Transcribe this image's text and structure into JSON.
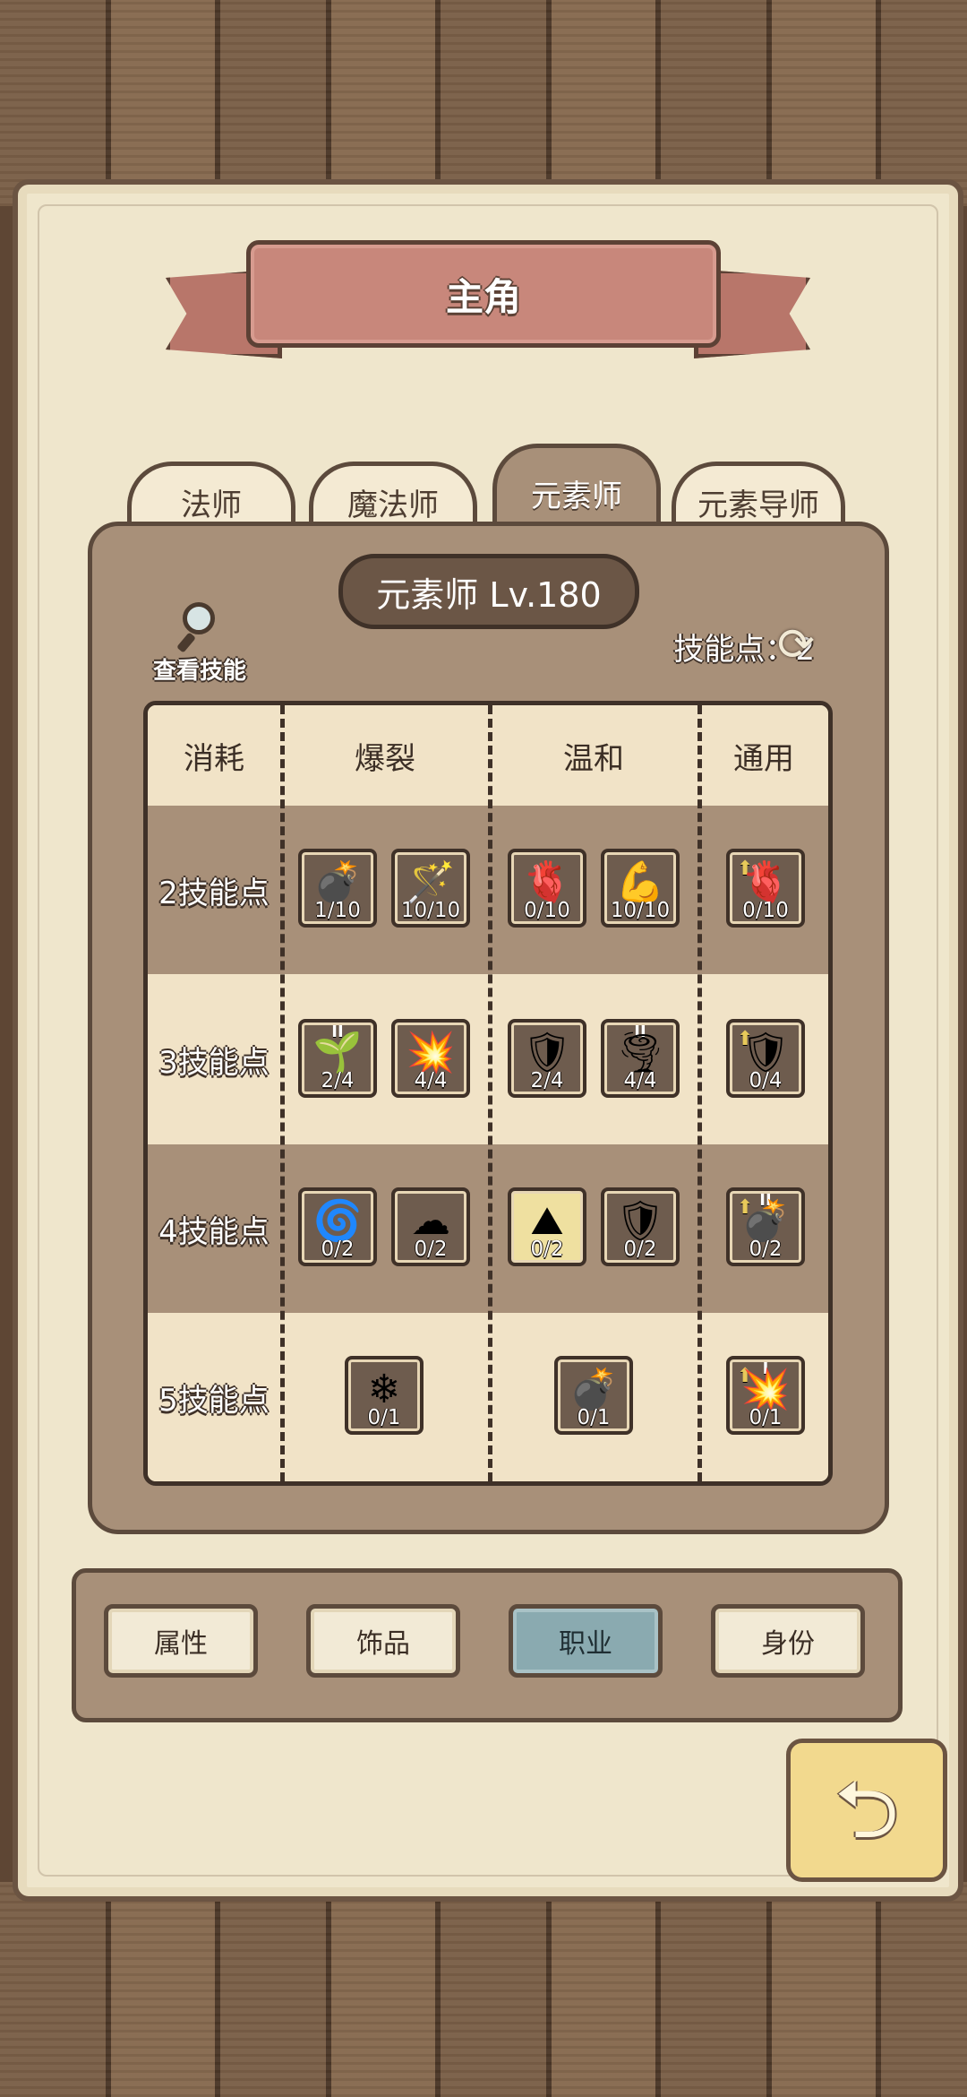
{
  "title": "主角",
  "tabs": [
    {
      "label": "法师",
      "active": false
    },
    {
      "label": "魔法师",
      "active": false
    },
    {
      "label": "元素师",
      "active": true
    },
    {
      "label": "元素导师",
      "active": false
    }
  ],
  "class_level": "元素师 Lv.180",
  "view_skills_label": "查看技能",
  "skill_points_label": "技能点：2",
  "grid": {
    "headers": [
      "消耗",
      "爆裂",
      "温和",
      "通用"
    ],
    "rows": [
      {
        "cost": "2技能点",
        "skills": [
          {
            "icon": "bomb-skull-icon",
            "glyph": "💣",
            "count": "1/10"
          },
          {
            "icon": "staff-icon",
            "glyph": "🪄",
            "count": "10/10"
          },
          {
            "icon": "heart-icon",
            "glyph": "🫀",
            "count": "0/10"
          },
          {
            "icon": "arm-icon",
            "glyph": "💪",
            "count": "10/10"
          },
          {
            "icon": "heart-upgrade-icon",
            "glyph": "🫀",
            "count": "0/10"
          }
        ]
      },
      {
        "cost": "3技能点",
        "skills": [
          {
            "icon": "sprout-icon",
            "glyph": "🌱",
            "count": "2/4",
            "tier": "II"
          },
          {
            "icon": "explosion-skull-icon",
            "glyph": "💥",
            "count": "4/4"
          },
          {
            "icon": "broken-shield-icon",
            "glyph": "🛡",
            "count": "2/4"
          },
          {
            "icon": "tornado-icon",
            "glyph": "🌪",
            "count": "4/4",
            "tier": "II"
          },
          {
            "icon": "broken-shield-upgrade-icon",
            "glyph": "🛡",
            "count": "0/4"
          }
        ]
      },
      {
        "cost": "4技能点",
        "skills": [
          {
            "icon": "wind-icon",
            "glyph": "🌀",
            "count": "0/2"
          },
          {
            "icon": "cloud-swirl-icon",
            "glyph": "☁",
            "count": "0/2"
          },
          {
            "icon": "mountain-light-icon",
            "glyph": "⛰",
            "count": "0/2"
          },
          {
            "icon": "ice-shield-icon",
            "glyph": "🛡",
            "count": "0/2"
          },
          {
            "icon": "bomb-upgrade-icon",
            "glyph": "💣",
            "count": "0/2",
            "tier": "II"
          }
        ]
      },
      {
        "cost": "5技能点",
        "skills": [
          {
            "icon": "ice-shards-icon",
            "glyph": "❄",
            "count": "0/1"
          },
          {
            "icon": "grenade-icon",
            "glyph": "💣",
            "count": "0/1"
          },
          {
            "icon": "explosion-upgrade-icon",
            "glyph": "💥",
            "count": "0/1",
            "tier": "I"
          }
        ]
      }
    ]
  },
  "nav": [
    {
      "label": "属性",
      "active": false
    },
    {
      "label": "饰品",
      "active": false
    },
    {
      "label": "职业",
      "active": true
    },
    {
      "label": "身份",
      "active": false
    }
  ],
  "colors": {
    "parchment": "#efe6cc",
    "panel": "#a89079",
    "outline": "#3f3128",
    "banner": "#c8877b",
    "active_nav": "#8aaab0"
  }
}
